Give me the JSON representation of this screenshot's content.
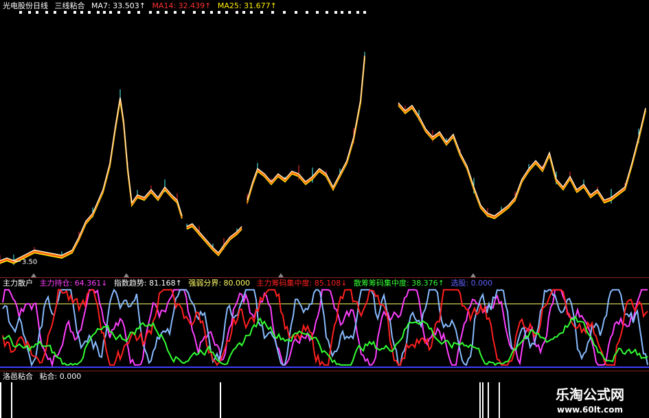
{
  "main_header": {
    "title": "光电股份日线",
    "indicator": "三线粘合",
    "ma7": "MA7: 33.503↑",
    "ma14": "MA14: 32.439↑",
    "ma25": "MA25: 31.677↑"
  },
  "indicator_header": {
    "name": "主力散户",
    "holding": "主力持仓: 64.361↓",
    "trend": "指数趋势: 81.168↑",
    "boundary": "强弱分界: 80.000",
    "main_conc": "主力筹码集中度: 85.108↓",
    "retail_conc": "散筹筹码集中度: 38.376↑",
    "pick": "选股: 0.000"
  },
  "bottom_header": {
    "name": "洛邑粘合",
    "value": "粘合: 0.000"
  },
  "low_label": "3.50",
  "watermark": {
    "title": "乐淘公式网",
    "url": "www.60lt.com"
  },
  "colors": {
    "ma7": "#ffffff",
    "ma14": "#ff3030",
    "ma25": "#ffee00",
    "price": "#ff9900",
    "holding": "#ff40ff",
    "trend": "#88bbff",
    "main_conc": "#ff2020",
    "retail_conc": "#33ff33",
    "pick": "#4040ff",
    "boundary": "#ffff66"
  },
  "chart_data": [
    {
      "type": "line",
      "title": "光电股份日线",
      "series": [
        {
          "name": "MA7",
          "value": 33.503
        },
        {
          "name": "MA14",
          "value": 32.439
        },
        {
          "name": "MA25",
          "value": 31.677
        }
      ],
      "points": [
        [
          0,
          3.5
        ],
        [
          10,
          3.6
        ],
        [
          20,
          3.5
        ],
        [
          35,
          3.7
        ],
        [
          50,
          3.9
        ],
        [
          70,
          3.8
        ],
        [
          90,
          3.7
        ],
        [
          105,
          3.9
        ],
        [
          115,
          4.4
        ],
        [
          125,
          5.0
        ],
        [
          135,
          5.3
        ],
        [
          150,
          6.2
        ],
        [
          160,
          7.2
        ],
        [
          168,
          8.6
        ],
        [
          175,
          9.7
        ],
        [
          180,
          8.8
        ],
        [
          186,
          7.0
        ],
        [
          192,
          5.7
        ],
        [
          200,
          6.0
        ],
        [
          210,
          5.9
        ],
        [
          220,
          6.2
        ],
        [
          230,
          5.9
        ],
        [
          240,
          6.3
        ],
        [
          250,
          6.0
        ],
        [
          258,
          5.8
        ],
        [
          265,
          5.2
        ],
        [
          272,
          4.8
        ],
        [
          280,
          4.9
        ],
        [
          290,
          4.6
        ],
        [
          300,
          4.3
        ],
        [
          310,
          4.0
        ],
        [
          318,
          3.8
        ],
        [
          326,
          4.1
        ],
        [
          335,
          4.4
        ],
        [
          345,
          4.6
        ],
        [
          352,
          4.8
        ],
        [
          360,
          5.8
        ],
        [
          368,
          6.5
        ],
        [
          375,
          7.0
        ],
        [
          385,
          6.8
        ],
        [
          395,
          6.5
        ],
        [
          405,
          6.8
        ],
        [
          415,
          6.6
        ],
        [
          425,
          6.9
        ],
        [
          435,
          6.8
        ],
        [
          445,
          6.5
        ],
        [
          455,
          6.7
        ],
        [
          465,
          7.0
        ],
        [
          475,
          6.8
        ],
        [
          485,
          6.3
        ],
        [
          495,
          6.8
        ],
        [
          505,
          7.3
        ],
        [
          515,
          8.2
        ],
        [
          525,
          9.6
        ],
        [
          531,
          11.3
        ],
        [
          580,
          9.5
        ],
        [
          590,
          9.2
        ],
        [
          600,
          9.4
        ],
        [
          610,
          9.0
        ],
        [
          620,
          8.5
        ],
        [
          630,
          8.2
        ],
        [
          640,
          8.4
        ],
        [
          650,
          8.0
        ],
        [
          660,
          8.3
        ],
        [
          670,
          7.6
        ],
        [
          680,
          7.1
        ],
        [
          690,
          6.3
        ],
        [
          700,
          5.6
        ],
        [
          710,
          5.3
        ],
        [
          720,
          5.2
        ],
        [
          730,
          5.4
        ],
        [
          740,
          5.6
        ],
        [
          750,
          5.9
        ],
        [
          760,
          6.6
        ],
        [
          770,
          7.0
        ],
        [
          780,
          7.3
        ],
        [
          790,
          7.0
        ],
        [
          800,
          7.6
        ],
        [
          810,
          6.6
        ],
        [
          820,
          6.3
        ],
        [
          830,
          6.7
        ],
        [
          840,
          6.2
        ],
        [
          850,
          6.4
        ],
        [
          860,
          6.0
        ],
        [
          870,
          6.2
        ],
        [
          880,
          5.8
        ],
        [
          890,
          5.9
        ],
        [
          900,
          6.1
        ],
        [
          910,
          6.3
        ],
        [
          920,
          7.2
        ],
        [
          930,
          8.2
        ],
        [
          940,
          9.3
        ]
      ]
    },
    {
      "type": "line",
      "title": "主力散户",
      "ylim": [
        0,
        100
      ],
      "boundary": 80,
      "series": [
        {
          "name": "主力持仓",
          "last": 64.361
        },
        {
          "name": "指数趋势",
          "last": 81.168
        },
        {
          "name": "主力筹码集中度",
          "last": 85.108
        },
        {
          "name": "散筹筹码集中度",
          "last": 38.376
        },
        {
          "name": "选股",
          "last": 0.0
        }
      ]
    },
    {
      "type": "bar",
      "title": "洛邑粘合",
      "series": [
        {
          "name": "粘合",
          "last": 0.0
        }
      ],
      "signal_x": [
        0,
        16,
        320,
        698,
        702,
        710,
        726
      ]
    }
  ]
}
